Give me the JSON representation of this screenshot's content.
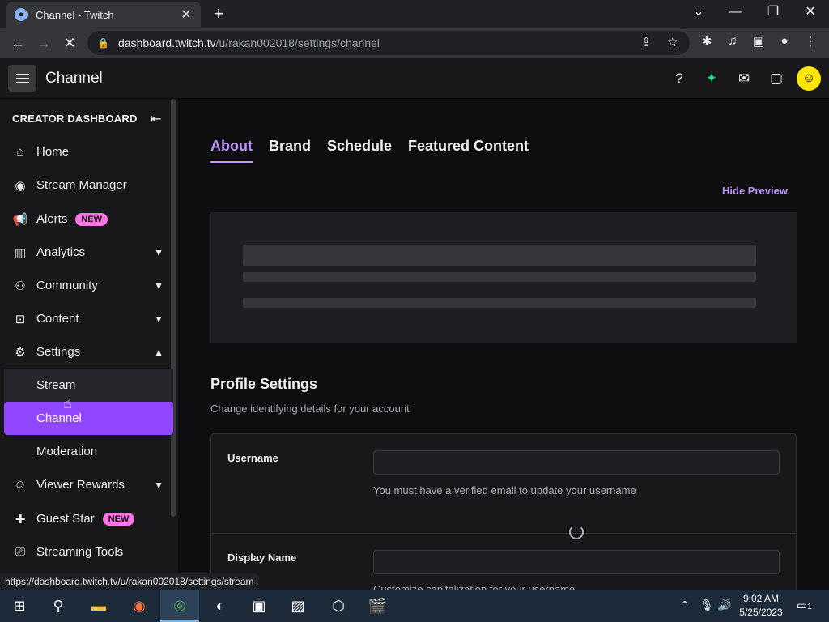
{
  "browser": {
    "tab_title": "Channel - Twitch",
    "url_host": "dashboard.twitch.tv",
    "url_path": "/u/rakan002018/settings/channel",
    "status_url": "https://dashboard.twitch.tv/u/rakan002018/settings/stream"
  },
  "topbar": {
    "page_title": "Channel"
  },
  "sidebar": {
    "header": "CREATOR DASHBOARD",
    "items": [
      {
        "label": "Home",
        "icon": "home-icon"
      },
      {
        "label": "Stream Manager",
        "icon": "broadcast-icon"
      },
      {
        "label": "Alerts",
        "icon": "megaphone-icon",
        "badge": "NEW"
      },
      {
        "label": "Analytics",
        "icon": "analytics-icon"
      },
      {
        "label": "Community",
        "icon": "community-icon"
      },
      {
        "label": "Content",
        "icon": "content-icon"
      },
      {
        "label": "Settings",
        "icon": "gear-icon"
      },
      {
        "label": "Stream"
      },
      {
        "label": "Channel"
      },
      {
        "label": "Moderation"
      },
      {
        "label": "Viewer Rewards",
        "icon": "rewards-icon"
      },
      {
        "label": "Guest Star",
        "icon": "guest-star-icon",
        "badge": "NEW"
      },
      {
        "label": "Streaming Tools",
        "icon": "tools-icon"
      }
    ]
  },
  "main": {
    "tabs": [
      "About",
      "Brand",
      "Schedule",
      "Featured Content"
    ],
    "active_tab": "About",
    "hide_preview": "Hide Preview",
    "profile_title": "Profile Settings",
    "profile_subtitle": "Change identifying details for your account",
    "username_label": "Username",
    "username_help": "You must have a verified email to update your username",
    "display_name_label": "Display Name",
    "display_name_help": "Customize capitalization for your username"
  },
  "taskbar": {
    "time": "9:02 AM",
    "date": "5/25/2023",
    "notifications": "1"
  },
  "colors": {
    "accent": "#9147ff",
    "accent_text": "#bf94ff",
    "badge": "#ff75e6",
    "background": "#0e0e10"
  }
}
